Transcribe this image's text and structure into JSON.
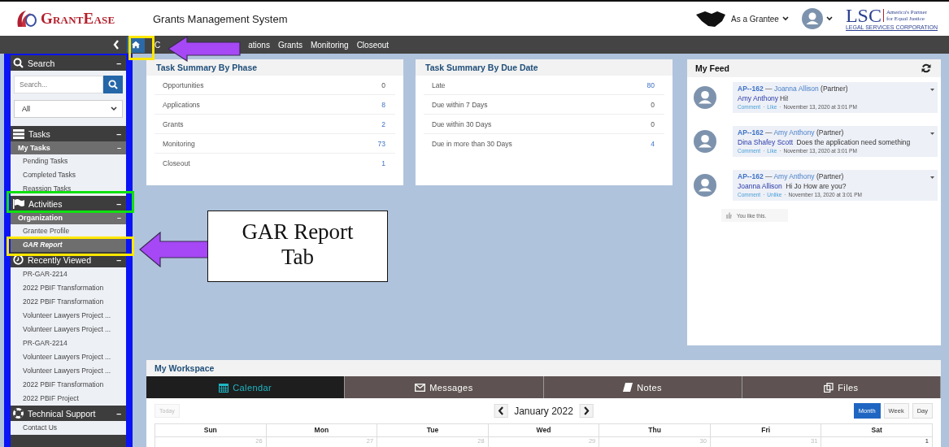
{
  "header": {
    "logo": "GrantEase",
    "title": "Grants Management System",
    "role_menu": "As a Grantee",
    "partner_logo": {
      "letters": "LSC",
      "tagline_1": "America's Partner",
      "tagline_2": "for Equal Justice",
      "name": "LEGAL SERVICES CORPORATION"
    }
  },
  "nav": {
    "home_selected": true,
    "items": [
      {
        "label": "C"
      },
      {
        "label": "ations"
      },
      {
        "label": "Grants"
      },
      {
        "label": "Monitoring"
      },
      {
        "label": "Closeout"
      }
    ]
  },
  "sidebar": {
    "sections": [
      {
        "kind": "search",
        "title": "Search",
        "toggle": "–",
        "placeholder": "Search...",
        "filter": "All"
      },
      {
        "kind": "tasks",
        "title": "Tasks",
        "toggle": "–",
        "group": "My Tasks",
        "group_toggle": "–",
        "items": [
          {
            "label": "Pending Tasks",
            "selected": false
          },
          {
            "label": "Completed Tasks",
            "selected": false
          },
          {
            "label": "Reassign Tasks",
            "selected": false
          }
        ]
      },
      {
        "kind": "activities",
        "title": "Activities",
        "toggle": "–",
        "group": "Organization",
        "group_toggle": "–",
        "items": [
          {
            "label": "Grantee Profile",
            "selected": false
          },
          {
            "label": "GAR Report",
            "selected": true
          }
        ]
      },
      {
        "kind": "recent",
        "title": "Recently Viewed",
        "toggle": "–",
        "items": [
          {
            "label": "PR-GAR-2214",
            "selected": false
          },
          {
            "label": "2022 PBIF Transformation",
            "selected": false
          },
          {
            "label": "2022 PBIF Transformation",
            "selected": false
          },
          {
            "label": "Volunteer Lawyers Project ...",
            "selected": false
          },
          {
            "label": "Volunteer Lawyers Project ...",
            "selected": false
          },
          {
            "label": "PR-GAR-2214",
            "selected": false
          },
          {
            "label": "Volunteer Lawyers Project ...",
            "selected": false
          },
          {
            "label": "Volunteer Lawyers Project ...",
            "selected": false
          },
          {
            "label": "2022 PBIF Transformation",
            "selected": false
          },
          {
            "label": "2022 PBIF Project",
            "selected": false
          }
        ]
      },
      {
        "kind": "support",
        "title": "Technical Support",
        "toggle": "–",
        "items": [
          {
            "label": "Contact Us",
            "selected": false
          }
        ]
      }
    ]
  },
  "summaries": [
    {
      "title": "Task Summary By Phase",
      "rows": [
        {
          "label": "Opportunities",
          "count": "0",
          "linked": false
        },
        {
          "label": "Applications",
          "count": "8",
          "linked": true
        },
        {
          "label": "Grants",
          "count": "2",
          "linked": true
        },
        {
          "label": "Monitoring",
          "count": "73",
          "linked": true
        },
        {
          "label": "Closeout",
          "count": "1",
          "linked": true
        }
      ]
    },
    {
      "title": "Task Summary By Due Date",
      "rows": [
        {
          "label": "Late",
          "count": "80",
          "linked": true
        },
        {
          "label": "Due within 7 Days",
          "count": "0",
          "linked": false
        },
        {
          "label": "Due within 30 Days",
          "count": "0",
          "linked": false
        },
        {
          "label": "Due in more than 30 Days",
          "count": "4",
          "linked": true
        }
      ]
    }
  ],
  "feed": {
    "title": "My Feed",
    "posts": [
      {
        "ref": "AP--162",
        "dash": "—",
        "author": "Joanna Allison",
        "role": "(Partner)",
        "mention": "Amy Anthony",
        "message": "Hi!",
        "actions": [
          "Comment",
          "Like"
        ],
        "separator": "·",
        "time": "November 13, 2020 at 3:01 PM"
      },
      {
        "ref": "AP--162",
        "dash": "—",
        "author": "Amy Anthony",
        "role": "(Partner)",
        "mention": "Dina Shafey Scott",
        "message": " Does the application need something",
        "actions": [
          "Comment",
          "Like"
        ],
        "separator": "·",
        "time": "November 13, 2020 at 3:01 PM"
      },
      {
        "ref": "AP--162",
        "dash": "—",
        "author": "Amy Anthony",
        "role": "(Partner)",
        "mention": "Joanna Allison",
        "message": " Hi Jo How are you?",
        "actions": [
          "Comment",
          "Unlike"
        ],
        "separator": "·",
        "time": "November 13, 2020 at 3:01 PM"
      }
    ],
    "likes": "You like this."
  },
  "workspace": {
    "title": "My Workspace",
    "tabs": [
      {
        "label": "Calendar",
        "kind": "calendar",
        "selected": true
      },
      {
        "label": "Messages",
        "kind": "messages",
        "selected": false
      },
      {
        "label": "Notes",
        "kind": "notes",
        "selected": false
      },
      {
        "label": "Files",
        "kind": "files",
        "selected": false
      }
    ],
    "today": "Today",
    "month": "January 2022",
    "views": [
      {
        "label": "Month",
        "selected": true
      },
      {
        "label": "Week",
        "selected": false
      },
      {
        "label": "Day",
        "selected": false
      }
    ],
    "weekdays": [
      "Sun",
      "Mon",
      "Tue",
      "Wed",
      "Thu",
      "Fri",
      "Sat"
    ],
    "dates": [
      {
        "day": "26",
        "other_month": true
      },
      {
        "day": "27",
        "other_month": true
      },
      {
        "day": "28",
        "other_month": true
      },
      {
        "day": "29",
        "other_month": true
      },
      {
        "day": "30",
        "other_month": true
      },
      {
        "day": "31",
        "other_month": true
      },
      {
        "day": "1",
        "other_month": false
      }
    ]
  },
  "annotation": {
    "callout": "GAR Report Tab"
  }
}
